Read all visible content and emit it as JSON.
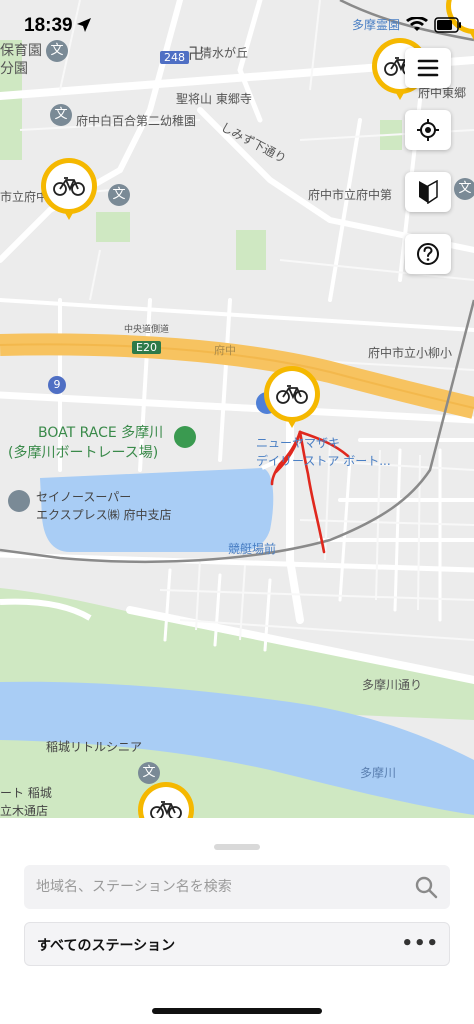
{
  "status": {
    "time": "18:39",
    "carrier_fragment": "多摩霊園"
  },
  "controls": {
    "menu_icon": "hamburger-icon",
    "locate_icon": "crosshair-icon",
    "beginner_icon": "beginner-mark-icon",
    "help_icon": "question-icon"
  },
  "map": {
    "labels": {
      "hoiku": "保育園",
      "bunen": "分園",
      "shimizugaoka": "清水が丘",
      "route248": "248",
      "shoshozan": "聖将山 東郷寺",
      "fuchu_kindergarten": "府中白百合第二幼稚園",
      "shimizushita": "しみず下通り",
      "fuchu_city_left": "市立府中",
      "fuchu_city_right": "府中市立府中第",
      "fuchu_east": "府中東郷",
      "chuo_side": "中央道側道",
      "e20": "E20",
      "fuchu_ka": "府中",
      "komayanagi": "府中市立小柳小",
      "route9": "9",
      "boatrace": "BOAT RACE 多摩川",
      "boatrace_sub": "(多摩川ボートレース場)",
      "newyamazaki": "ニューヤマザキ",
      "newyamazaki_sub": "デイリーストア ボート...",
      "seino": "セイノースーパー",
      "seino_sub": "エクスプレス㈱ 府中支店",
      "kyoteijomae": "競艇場前",
      "tamagawa_dori": "多摩川通り",
      "inagi_little": "稲城リトルシニア",
      "tamagawa_river": "多摩川",
      "inagi_left1": "ート 稲城",
      "inagi_left2": "立木通店",
      "bun": "文"
    },
    "pins": [
      {
        "name": "bike-station",
        "icon": "bicycle-icon"
      },
      {
        "name": "bike-station",
        "icon": "bicycle-icon"
      },
      {
        "name": "bike-station",
        "icon": "bicycle-icon"
      },
      {
        "name": "bike-station",
        "icon": "bicycle-icon"
      }
    ]
  },
  "sheet": {
    "search_placeholder": "地域名、ステーション名を検索",
    "station_filter": "すべてのステーション",
    "more": "•••"
  },
  "colors": {
    "pin": "#f5b800",
    "highway": "#f7c360",
    "water": "#a9cdf5",
    "park": "#cfe8c2",
    "annotation": "#e0281e"
  }
}
